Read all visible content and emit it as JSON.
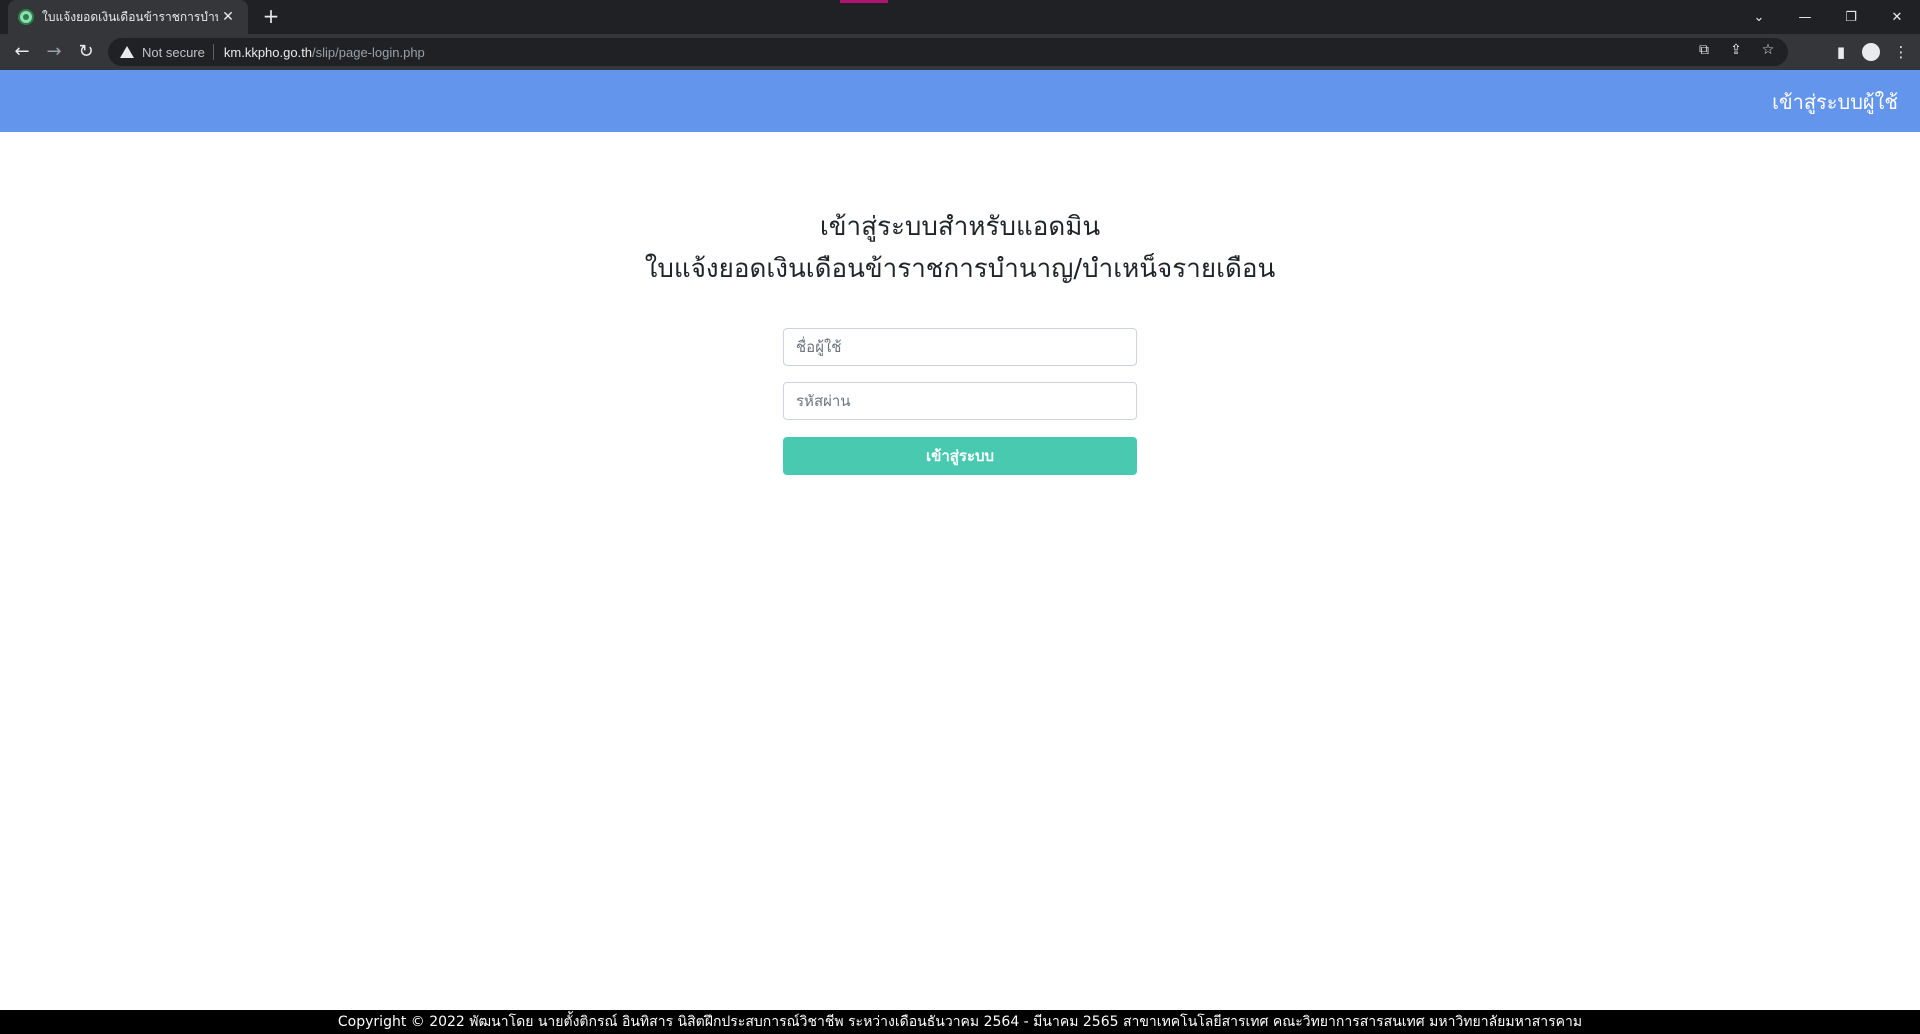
{
  "browser": {
    "tab_title": "ใบแจ้งยอดเงินเดือนข้าราชการบำนาญ/",
    "tab_close": "✕",
    "new_tab": "+",
    "security_label": "Not secure",
    "url_host": "km.kkpho.go.th",
    "url_path": "/slip/page-login.php",
    "window_controls": [
      "⌄",
      "—",
      "❐",
      "✕"
    ]
  },
  "navbar": {
    "login_link": "เข้าสู่ระบบผู้ใช้"
  },
  "main": {
    "title_line1": "เข้าสู่ระบบสำหรับแอดมิน",
    "title_line2": "ใบแจ้งยอดเงินเดือนข้าราชการบำนาญ/บำเหน็จรายเดือน",
    "username_placeholder": "ชื่อผู้ใช้",
    "password_placeholder": "รหัสผ่าน",
    "submit_label": "เข้าสู่ระบบ"
  },
  "footer": {
    "text": "Copyright © 2022 พัฒนาโดย นายตั้งติกรณ์ อินทิสาร นิสิตฝึกประสบการณ์วิชาชีพ ระหว่างเดือนธันวาคม 2564 - มีนาคม 2565 สาขาเทคโนโลยีสารเทศ คณะวิทยาการสารสนเทศ มหาวิทยาลัยมหาสารคาม"
  },
  "colors": {
    "navbar": "#6495ed",
    "button": "#48c9b0",
    "footer": "#000000"
  }
}
